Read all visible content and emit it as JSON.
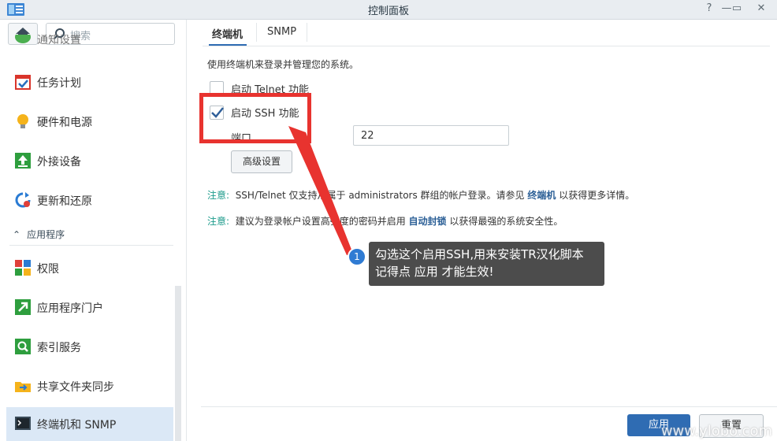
{
  "window": {
    "title": "控制面板",
    "help": "?",
    "minimize": "—",
    "maximize": "▭",
    "close": "✕"
  },
  "sidebar": {
    "search_placeholder": "搜索",
    "partial_item": "通知设置",
    "items": [
      {
        "label": "任务计划",
        "icon": "calendar-check-icon"
      },
      {
        "label": "硬件和电源",
        "icon": "lightbulb-icon"
      },
      {
        "label": "外接设备",
        "icon": "upload-device-icon"
      },
      {
        "label": "更新和还原",
        "icon": "refresh-icon"
      }
    ],
    "section": "应用程序",
    "app_items": [
      {
        "label": "权限",
        "icon": "grid-squares-icon"
      },
      {
        "label": "应用程序门户",
        "icon": "arrow-portal-icon"
      },
      {
        "label": "索引服务",
        "icon": "magnifier-icon"
      },
      {
        "label": "共享文件夹同步",
        "icon": "folder-sync-icon"
      },
      {
        "label": "终端机和 SNMP",
        "icon": "terminal-icon"
      }
    ]
  },
  "tabs": [
    "终端机",
    "SNMP"
  ],
  "main": {
    "description": "使用终端机来登录并管理您的系统。",
    "telnet_label": "启动 Telnet 功能",
    "telnet_checked": false,
    "ssh_label": "启动 SSH 功能",
    "ssh_checked": true,
    "port_label": "端口",
    "port_value": "22",
    "advanced_button": "高级设置",
    "note1": {
      "label": "注意:",
      "text_a": "SSH/Telnet 仅支持从属于 administrators 群组的帐户登录。请参见",
      "link": "终端机",
      "text_b": "以获得更多详情。"
    },
    "note2": {
      "label": "注意:",
      "text_a": "建议为登录帐户设置高强度的密码并启用",
      "link": "自动封锁",
      "text_b": "以获得最强的系统安全性。"
    }
  },
  "footer": {
    "apply": "应用",
    "reset": "重置"
  },
  "annotation": {
    "badge": "1",
    "callout_line1": "勾选这个启用SSH,用来安装TR汉化脚本",
    "callout_line2": "记得点 应用 才能生效!",
    "highlight_color": "#e8332f"
  },
  "watermark": "www.ylobo.com"
}
